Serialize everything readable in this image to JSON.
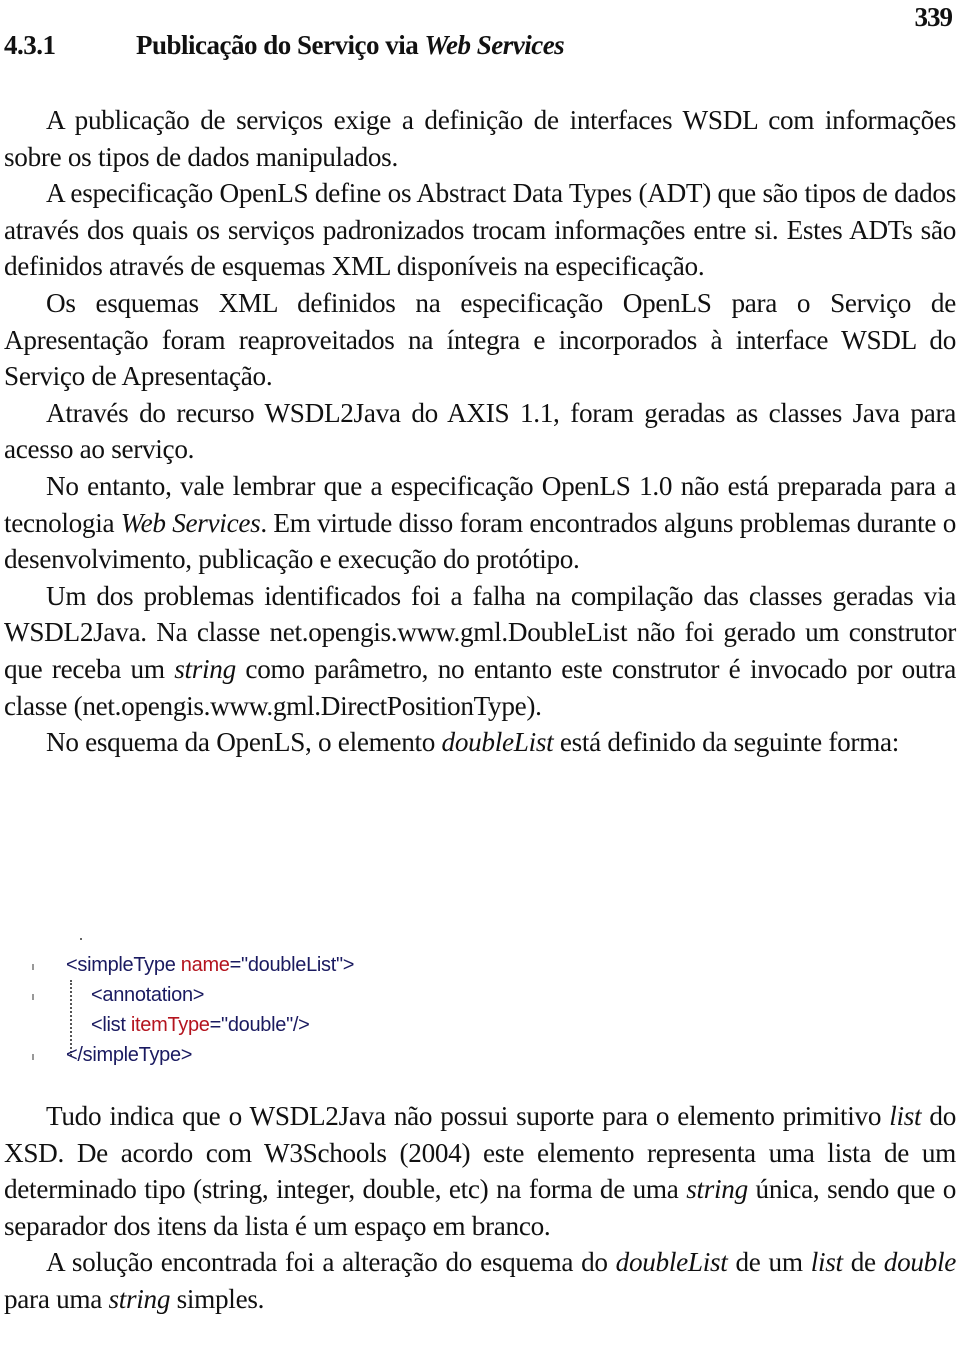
{
  "page": {
    "number": "339",
    "heading": {
      "number": "4.3.1",
      "title_plain": "Publicação do Serviço via ",
      "title_italic": "Web Services"
    }
  },
  "paragraphs_top": [
    {
      "text": "A publicação de serviços exige a definição de interfaces WSDL com informações sobre os tipos de dados manipulados."
    },
    {
      "text": "A especificação OpenLS define os Abstract Data Types (ADT) que são tipos de dados através dos quais os serviços padronizados trocam informações entre si. Estes ADTs são definidos através de esquemas XML disponíveis na especificação."
    },
    {
      "text": "Os esquemas XML definidos na especificação OpenLS para o Serviço de Apresentação foram reaproveitados na íntegra e incorporados à interface WSDL do Serviço de Apresentação."
    },
    {
      "text": "Através do recurso WSDL2Java do AXIS 1.1, foram geradas as classes Java para acesso ao serviço."
    },
    {
      "p1": "No entanto, vale lembrar que a especificação OpenLS 1.0 não está preparada para a tecnologia ",
      "i1": "Web Services",
      "p2": ". Em virtude disso foram encontrados alguns problemas durante o desenvolvimento, publicação e execução do protótipo."
    },
    {
      "p1": "Um dos problemas identificados foi a falha na compilação das classes geradas via WSDL2Java. Na classe net.opengis.www.gml.DoubleList  não foi gerado um construtor que receba um ",
      "i1": "string",
      "p2": " como parâmetro, no entanto este construtor é invocado por outra classe (net.opengis.www.gml.DirectPositionType)."
    },
    {
      "p1": "No esquema da OpenLS, o elemento ",
      "i1": "doubleList",
      "p2": " está definido da seguinte forma:"
    }
  ],
  "code_figure": {
    "colors": {
      "tag": "#1a1a60",
      "attribute": "#b4141e"
    },
    "lines": [
      {
        "tag_open": "<simpleType ",
        "attr": "name",
        "rest": "=\"doubleList\">"
      },
      {
        "tag_open": "<annotation>",
        "attr": "",
        "rest": ""
      },
      {
        "tag_open": "<list ",
        "attr": "itemType",
        "rest": "=\"double\"/>"
      },
      {
        "tag_open": "</simpleType>",
        "attr": "",
        "rest": ""
      }
    ]
  },
  "paragraphs_bottom": [
    {
      "p1": "Tudo indica que o WSDL2Java não possui suporte para o elemento primitivo ",
      "i1": "list",
      "p2": " do XSD. De acordo com W3Schools (2004) este elemento representa uma lista de um determinado tipo (string, integer, double, etc) na forma de uma ",
      "i2": "string",
      "p3": " única, sendo que o separador dos itens da lista é um espaço em branco."
    },
    {
      "p1": "A solução encontrada foi a alteração do esquema do ",
      "i1": "doubleList",
      "p2": " de um ",
      "i2": "list",
      "p3": " de ",
      "i3": "double",
      "p4": " para uma ",
      "i4": "string",
      "p5": " simples."
    }
  ]
}
